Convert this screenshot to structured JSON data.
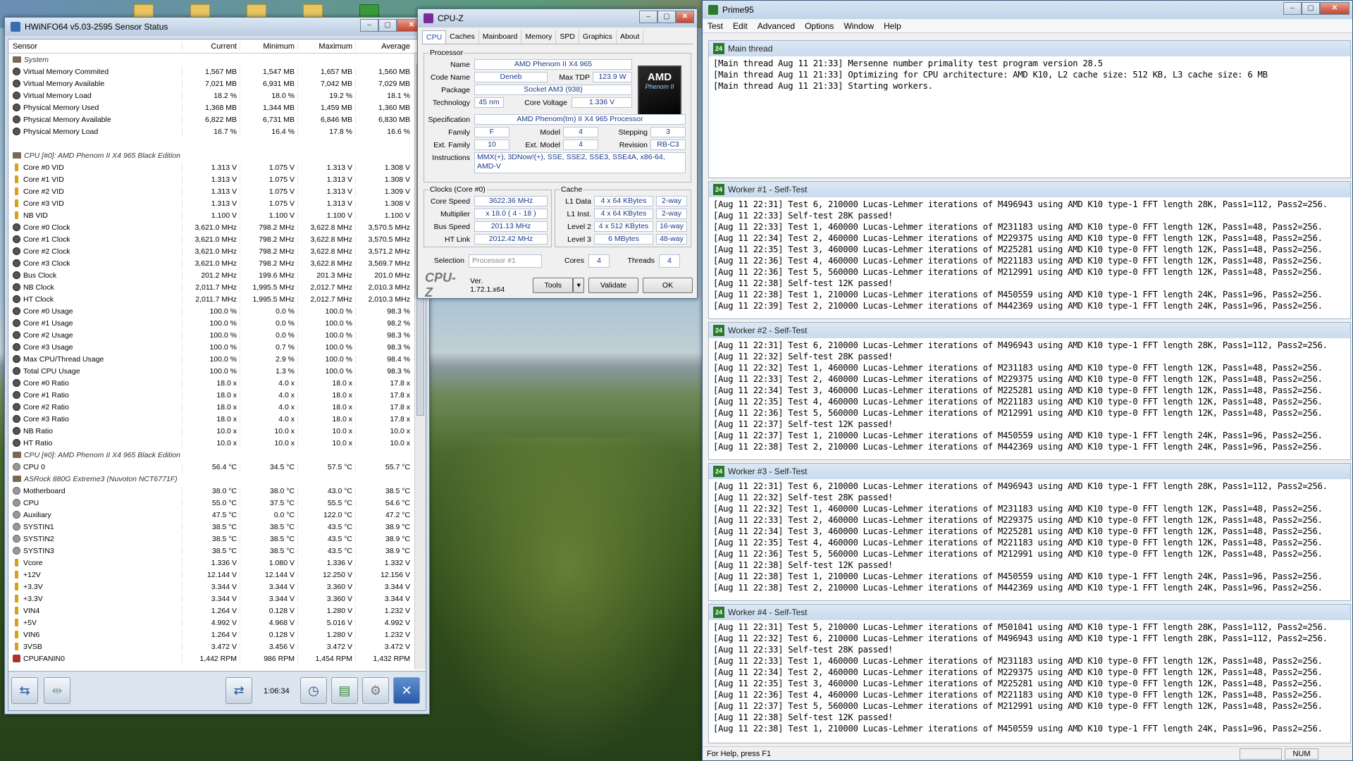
{
  "hwinfo": {
    "title": "HWiNFO64 v5.03-2595 Sensor Status",
    "columns": [
      "Sensor",
      "Current",
      "Minimum",
      "Maximum",
      "Average"
    ],
    "timer": "1:06:34",
    "rows": [
      {
        "g": true,
        "i": "grp",
        "n": "System",
        "v": [
          "",
          "",
          "",
          ""
        ]
      },
      {
        "i": "mem",
        "n": "Virtual Memory Commited",
        "v": [
          "1,567 MB",
          "1,547 MB",
          "1,657 MB",
          "1,560 MB"
        ]
      },
      {
        "i": "mem",
        "n": "Virtual Memory Available",
        "v": [
          "7,021 MB",
          "6,931 MB",
          "7,042 MB",
          "7,029 MB"
        ]
      },
      {
        "i": "mem",
        "n": "Virtual Memory Load",
        "v": [
          "18.2 %",
          "18.0 %",
          "19.2 %",
          "18.1 %"
        ]
      },
      {
        "i": "mem",
        "n": "Physical Memory Used",
        "v": [
          "1,368 MB",
          "1,344 MB",
          "1,459 MB",
          "1,360 MB"
        ]
      },
      {
        "i": "mem",
        "n": "Physical Memory Available",
        "v": [
          "6,822 MB",
          "6,731 MB",
          "6,846 MB",
          "6,830 MB"
        ]
      },
      {
        "i": "mem",
        "n": "Physical Memory Load",
        "v": [
          "16.7 %",
          "16.4 %",
          "17.8 %",
          "16.6 %"
        ]
      },
      {
        "i": "",
        "n": "",
        "v": [
          "",
          "",
          "",
          ""
        ]
      },
      {
        "g": true,
        "i": "grp",
        "n": "CPU [#0]: AMD Phenom II X4 965 Black Edition",
        "v": [
          "",
          "",
          "",
          ""
        ]
      },
      {
        "i": "cpu",
        "n": "Core #0 VID",
        "v": [
          "1.313 V",
          "1.075 V",
          "1.313 V",
          "1.308 V"
        ]
      },
      {
        "i": "cpu",
        "n": "Core #1 VID",
        "v": [
          "1.313 V",
          "1.075 V",
          "1.313 V",
          "1.308 V"
        ]
      },
      {
        "i": "cpu",
        "n": "Core #2 VID",
        "v": [
          "1.313 V",
          "1.075 V",
          "1.313 V",
          "1.309 V"
        ]
      },
      {
        "i": "cpu",
        "n": "Core #3 VID",
        "v": [
          "1.313 V",
          "1.075 V",
          "1.313 V",
          "1.308 V"
        ]
      },
      {
        "i": "cpu",
        "n": "NB VID",
        "v": [
          "1.100 V",
          "1.100 V",
          "1.100 V",
          "1.100 V"
        ]
      },
      {
        "i": "mem",
        "n": "Core #0 Clock",
        "v": [
          "3,621.0 MHz",
          "798.2 MHz",
          "3,622.8 MHz",
          "3,570.5 MHz"
        ]
      },
      {
        "i": "mem",
        "n": "Core #1 Clock",
        "v": [
          "3,621.0 MHz",
          "798.2 MHz",
          "3,622.8 MHz",
          "3,570.5 MHz"
        ]
      },
      {
        "i": "mem",
        "n": "Core #2 Clock",
        "v": [
          "3,621.0 MHz",
          "798.2 MHz",
          "3,622.8 MHz",
          "3,571.2 MHz"
        ]
      },
      {
        "i": "mem",
        "n": "Core #3 Clock",
        "v": [
          "3,621.0 MHz",
          "798.2 MHz",
          "3,622.8 MHz",
          "3,569.7 MHz"
        ]
      },
      {
        "i": "mem",
        "n": "Bus Clock",
        "v": [
          "201.2 MHz",
          "199.6 MHz",
          "201.3 MHz",
          "201.0 MHz"
        ]
      },
      {
        "i": "mem",
        "n": "NB Clock",
        "v": [
          "2,011.7 MHz",
          "1,995.5 MHz",
          "2,012.7 MHz",
          "2,010.3 MHz"
        ]
      },
      {
        "i": "mem",
        "n": "HT Clock",
        "v": [
          "2,011.7 MHz",
          "1,995.5 MHz",
          "2,012.7 MHz",
          "2,010.3 MHz"
        ]
      },
      {
        "i": "mem",
        "n": "Core #0 Usage",
        "v": [
          "100.0 %",
          "0.0 %",
          "100.0 %",
          "98.3 %"
        ]
      },
      {
        "i": "mem",
        "n": "Core #1 Usage",
        "v": [
          "100.0 %",
          "0.0 %",
          "100.0 %",
          "98.2 %"
        ]
      },
      {
        "i": "mem",
        "n": "Core #2 Usage",
        "v": [
          "100.0 %",
          "0.0 %",
          "100.0 %",
          "98.3 %"
        ]
      },
      {
        "i": "mem",
        "n": "Core #3 Usage",
        "v": [
          "100.0 %",
          "0.7 %",
          "100.0 %",
          "98.3 %"
        ]
      },
      {
        "i": "mem",
        "n": "Max CPU/Thread Usage",
        "v": [
          "100.0 %",
          "2.9 %",
          "100.0 %",
          "98.4 %"
        ]
      },
      {
        "i": "mem",
        "n": "Total CPU Usage",
        "v": [
          "100.0 %",
          "1.3 %",
          "100.0 %",
          "98.3 %"
        ]
      },
      {
        "i": "mem",
        "n": "Core #0 Ratio",
        "v": [
          "18.0 x",
          "4.0 x",
          "18.0 x",
          "17.8 x"
        ]
      },
      {
        "i": "mem",
        "n": "Core #1 Ratio",
        "v": [
          "18.0 x",
          "4.0 x",
          "18.0 x",
          "17.8 x"
        ]
      },
      {
        "i": "mem",
        "n": "Core #2 Ratio",
        "v": [
          "18.0 x",
          "4.0 x",
          "18.0 x",
          "17.8 x"
        ]
      },
      {
        "i": "mem",
        "n": "Core #3 Ratio",
        "v": [
          "18.0 x",
          "4.0 x",
          "18.0 x",
          "17.8 x"
        ]
      },
      {
        "i": "mem",
        "n": "NB Ratio",
        "v": [
          "10.0 x",
          "10.0 x",
          "10.0 x",
          "10.0 x"
        ]
      },
      {
        "i": "mem",
        "n": "HT Ratio",
        "v": [
          "10.0 x",
          "10.0 x",
          "10.0 x",
          "10.0 x"
        ]
      },
      {
        "g": true,
        "i": "grp",
        "n": "CPU [#0]: AMD Phenom II X4 965 Black Edition",
        "v": [
          "",
          "",
          "",
          ""
        ]
      },
      {
        "i": "therm",
        "n": "CPU 0",
        "v": [
          "56.4 °C",
          "34.5 °C",
          "57.5 °C",
          "55.7 °C"
        ]
      },
      {
        "g": true,
        "i": "grp",
        "n": "ASRock 880G Extreme3 (Nuvoton NCT6771F)",
        "v": [
          "",
          "",
          "",
          ""
        ]
      },
      {
        "i": "therm",
        "n": "Motherboard",
        "v": [
          "38.0 °C",
          "38.0 °C",
          "43.0 °C",
          "38.5 °C"
        ]
      },
      {
        "i": "therm",
        "n": "CPU",
        "v": [
          "55.0 °C",
          "37.5 °C",
          "55.5 °C",
          "54.6 °C"
        ]
      },
      {
        "i": "therm",
        "n": "Auxiliary",
        "v": [
          "47.5 °C",
          "0.0 °C",
          "122.0 °C",
          "47.2 °C"
        ]
      },
      {
        "i": "therm",
        "n": "SYSTIN1",
        "v": [
          "38.5 °C",
          "38.5 °C",
          "43.5 °C",
          "38.9 °C"
        ]
      },
      {
        "i": "therm",
        "n": "SYSTIN2",
        "v": [
          "38.5 °C",
          "38.5 °C",
          "43.5 °C",
          "38.9 °C"
        ]
      },
      {
        "i": "therm",
        "n": "SYSTIN3",
        "v": [
          "38.5 °C",
          "38.5 °C",
          "43.5 °C",
          "38.9 °C"
        ]
      },
      {
        "i": "cpu",
        "n": "Vcore",
        "v": [
          "1.336 V",
          "1.080 V",
          "1.336 V",
          "1.332 V"
        ]
      },
      {
        "i": "cpu",
        "n": "+12V",
        "v": [
          "12.144 V",
          "12.144 V",
          "12.250 V",
          "12.156 V"
        ]
      },
      {
        "i": "cpu",
        "n": "+3.3V",
        "v": [
          "3.344 V",
          "3.344 V",
          "3.360 V",
          "3.344 V"
        ]
      },
      {
        "i": "cpu",
        "n": "+3.3V",
        "v": [
          "3.344 V",
          "3.344 V",
          "3.360 V",
          "3.344 V"
        ]
      },
      {
        "i": "cpu",
        "n": "VIN4",
        "v": [
          "1.264 V",
          "0.128 V",
          "1.280 V",
          "1.232 V"
        ]
      },
      {
        "i": "cpu",
        "n": "+5V",
        "v": [
          "4.992 V",
          "4.968 V",
          "5.016 V",
          "4.992 V"
        ]
      },
      {
        "i": "cpu",
        "n": "VIN6",
        "v": [
          "1.264 V",
          "0.128 V",
          "1.280 V",
          "1.232 V"
        ]
      },
      {
        "i": "cpu",
        "n": "3VSB",
        "v": [
          "3.472 V",
          "3.456 V",
          "3.472 V",
          "3.472 V"
        ]
      },
      {
        "i": "fan",
        "n": "CPUFANIN0",
        "v": [
          "1,442 RPM",
          "986 RPM",
          "1,454 RPM",
          "1,432 RPM"
        ]
      }
    ]
  },
  "cpuz": {
    "title": "CPU-Z",
    "tabs": [
      "CPU",
      "Caches",
      "Mainboard",
      "Memory",
      "SPD",
      "Graphics",
      "About"
    ],
    "processor_legend": "Processor",
    "name_label": "Name",
    "name": "AMD Phenom II X4 965",
    "codename_label": "Code Name",
    "codename": "Deneb",
    "maxtdp_label": "Max TDP",
    "maxtdp": "123.9 W",
    "package_label": "Package",
    "package": "Socket AM3 (938)",
    "tech_label": "Technology",
    "tech": "45 nm",
    "corevolt_label": "Core Voltage",
    "corevolt": "1.336 V",
    "spec_label": "Specification",
    "spec": "AMD Phenom(tm) II X4 965 Processor",
    "family_label": "Family",
    "family": "F",
    "model_label": "Model",
    "model": "4",
    "stepping_label": "Stepping",
    "stepping": "3",
    "extfam_label": "Ext. Family",
    "extfam": "10",
    "extmodel_label": "Ext. Model",
    "extmodel": "4",
    "revision_label": "Revision",
    "revision": "RB-C3",
    "instr_label": "Instructions",
    "instr": "MMX(+), 3DNow!(+), SSE, SSE2, SSE3, SSE4A, x86-64, AMD-V",
    "logo_text": "AMD",
    "logo_sub": "Phenom II",
    "clocks_legend": "Clocks (Core #0)",
    "corespeed_label": "Core Speed",
    "corespeed": "3622.36 MHz",
    "multiplier_label": "Multiplier",
    "multiplier": "x 18.0 ( 4 - 18 )",
    "busspeed_label": "Bus Speed",
    "busspeed": "201.13 MHz",
    "htlink_label": "HT Link",
    "htlink": "2012.42 MHz",
    "cache_legend": "Cache",
    "l1d_label": "L1 Data",
    "l1d": "4 x 64 KBytes",
    "l1d_way": "2-way",
    "l1i_label": "L1 Inst.",
    "l1i": "4 x 64 KBytes",
    "l1i_way": "2-way",
    "l2_label": "Level 2",
    "l2": "4 x 512 KBytes",
    "l2_way": "16-way",
    "l3_label": "Level 3",
    "l3": "6 MBytes",
    "l3_way": "48-way",
    "selection_label": "Selection",
    "selection": "Processor #1",
    "cores_label": "Cores",
    "cores": "4",
    "threads_label": "Threads",
    "threads": "4",
    "brand": "CPU-Z",
    "version": "Ver. 1.72.1.x64",
    "tools": "Tools",
    "validate": "Validate",
    "ok": "OK"
  },
  "prime95": {
    "title": "Prime95",
    "menu": [
      "Test",
      "Edit",
      "Advanced",
      "Options",
      "Window",
      "Help"
    ],
    "status": "For Help, press F1",
    "num": "NUM",
    "main": {
      "title": "Main thread",
      "lines": [
        "[Main thread Aug 11 21:33] Mersenne number primality test program version 28.5",
        "[Main thread Aug 11 21:33] Optimizing for CPU architecture: AMD K10, L2 cache size: 512 KB, L3 cache size: 6 MB",
        "[Main thread Aug 11 21:33] Starting workers."
      ]
    },
    "workers": [
      {
        "title": "Worker #1 - Self-Test",
        "lines": [
          "[Aug 11 22:31] Test 6, 210000 Lucas-Lehmer iterations of M496943 using AMD K10 type-1 FFT length 28K, Pass1=112, Pass2=256.",
          "[Aug 11 22:33] Self-test 28K passed!",
          "[Aug 11 22:33] Test 1, 460000 Lucas-Lehmer iterations of M231183 using AMD K10 type-0 FFT length 12K, Pass1=48, Pass2=256.",
          "[Aug 11 22:34] Test 2, 460000 Lucas-Lehmer iterations of M229375 using AMD K10 type-0 FFT length 12K, Pass1=48, Pass2=256.",
          "[Aug 11 22:35] Test 3, 460000 Lucas-Lehmer iterations of M225281 using AMD K10 type-0 FFT length 12K, Pass1=48, Pass2=256.",
          "[Aug 11 22:36] Test 4, 460000 Lucas-Lehmer iterations of M221183 using AMD K10 type-0 FFT length 12K, Pass1=48, Pass2=256.",
          "[Aug 11 22:36] Test 5, 560000 Lucas-Lehmer iterations of M212991 using AMD K10 type-0 FFT length 12K, Pass1=48, Pass2=256.",
          "[Aug 11 22:38] Self-test 12K passed!",
          "[Aug 11 22:38] Test 1, 210000 Lucas-Lehmer iterations of M450559 using AMD K10 type-1 FFT length 24K, Pass1=96, Pass2=256.",
          "[Aug 11 22:39] Test 2, 210000 Lucas-Lehmer iterations of M442369 using AMD K10 type-1 FFT length 24K, Pass1=96, Pass2=256."
        ]
      },
      {
        "title": "Worker #2 - Self-Test",
        "lines": [
          "[Aug 11 22:31] Test 6, 210000 Lucas-Lehmer iterations of M496943 using AMD K10 type-1 FFT length 28K, Pass1=112, Pass2=256.",
          "[Aug 11 22:32] Self-test 28K passed!",
          "[Aug 11 22:32] Test 1, 460000 Lucas-Lehmer iterations of M231183 using AMD K10 type-0 FFT length 12K, Pass1=48, Pass2=256.",
          "[Aug 11 22:33] Test 2, 460000 Lucas-Lehmer iterations of M229375 using AMD K10 type-0 FFT length 12K, Pass1=48, Pass2=256.",
          "[Aug 11 22:34] Test 3, 460000 Lucas-Lehmer iterations of M225281 using AMD K10 type-0 FFT length 12K, Pass1=48, Pass2=256.",
          "[Aug 11 22:35] Test 4, 460000 Lucas-Lehmer iterations of M221183 using AMD K10 type-0 FFT length 12K, Pass1=48, Pass2=256.",
          "[Aug 11 22:36] Test 5, 560000 Lucas-Lehmer iterations of M212991 using AMD K10 type-0 FFT length 12K, Pass1=48, Pass2=256.",
          "[Aug 11 22:37] Self-test 12K passed!",
          "[Aug 11 22:37] Test 1, 210000 Lucas-Lehmer iterations of M450559 using AMD K10 type-1 FFT length 24K, Pass1=96, Pass2=256.",
          "[Aug 11 22:38] Test 2, 210000 Lucas-Lehmer iterations of M442369 using AMD K10 type-1 FFT length 24K, Pass1=96, Pass2=256."
        ]
      },
      {
        "title": "Worker #3 - Self-Test",
        "lines": [
          "[Aug 11 22:31] Test 6, 210000 Lucas-Lehmer iterations of M496943 using AMD K10 type-1 FFT length 28K, Pass1=112, Pass2=256.",
          "[Aug 11 22:32] Self-test 28K passed!",
          "[Aug 11 22:32] Test 1, 460000 Lucas-Lehmer iterations of M231183 using AMD K10 type-0 FFT length 12K, Pass1=48, Pass2=256.",
          "[Aug 11 22:33] Test 2, 460000 Lucas-Lehmer iterations of M229375 using AMD K10 type-0 FFT length 12K, Pass1=48, Pass2=256.",
          "[Aug 11 22:34] Test 3, 460000 Lucas-Lehmer iterations of M225281 using AMD K10 type-0 FFT length 12K, Pass1=48, Pass2=256.",
          "[Aug 11 22:35] Test 4, 460000 Lucas-Lehmer iterations of M221183 using AMD K10 type-0 FFT length 12K, Pass1=48, Pass2=256.",
          "[Aug 11 22:36] Test 5, 560000 Lucas-Lehmer iterations of M212991 using AMD K10 type-0 FFT length 12K, Pass1=48, Pass2=256.",
          "[Aug 11 22:38] Self-test 12K passed!",
          "[Aug 11 22:38] Test 1, 210000 Lucas-Lehmer iterations of M450559 using AMD K10 type-1 FFT length 24K, Pass1=96, Pass2=256.",
          "[Aug 11 22:38] Test 2, 210000 Lucas-Lehmer iterations of M442369 using AMD K10 type-1 FFT length 24K, Pass1=96, Pass2=256."
        ]
      },
      {
        "title": "Worker #4 - Self-Test",
        "lines": [
          "[Aug 11 22:31] Test 5, 210000 Lucas-Lehmer iterations of M501041 using AMD K10 type-1 FFT length 28K, Pass1=112, Pass2=256.",
          "[Aug 11 22:32] Test 6, 210000 Lucas-Lehmer iterations of M496943 using AMD K10 type-1 FFT length 28K, Pass1=112, Pass2=256.",
          "[Aug 11 22:33] Self-test 28K passed!",
          "[Aug 11 22:33] Test 1, 460000 Lucas-Lehmer iterations of M231183 using AMD K10 type-0 FFT length 12K, Pass1=48, Pass2=256.",
          "[Aug 11 22:34] Test 2, 460000 Lucas-Lehmer iterations of M229375 using AMD K10 type-0 FFT length 12K, Pass1=48, Pass2=256.",
          "[Aug 11 22:35] Test 3, 460000 Lucas-Lehmer iterations of M225281 using AMD K10 type-0 FFT length 12K, Pass1=48, Pass2=256.",
          "[Aug 11 22:36] Test 4, 460000 Lucas-Lehmer iterations of M221183 using AMD K10 type-0 FFT length 12K, Pass1=48, Pass2=256.",
          "[Aug 11 22:37] Test 5, 560000 Lucas-Lehmer iterations of M212991 using AMD K10 type-0 FFT length 12K, Pass1=48, Pass2=256.",
          "[Aug 11 22:38] Self-test 12K passed!",
          "[Aug 11 22:38] Test 1, 210000 Lucas-Lehmer iterations of M450559 using AMD K10 type-1 FFT length 24K, Pass1=96, Pass2=256."
        ]
      }
    ]
  }
}
